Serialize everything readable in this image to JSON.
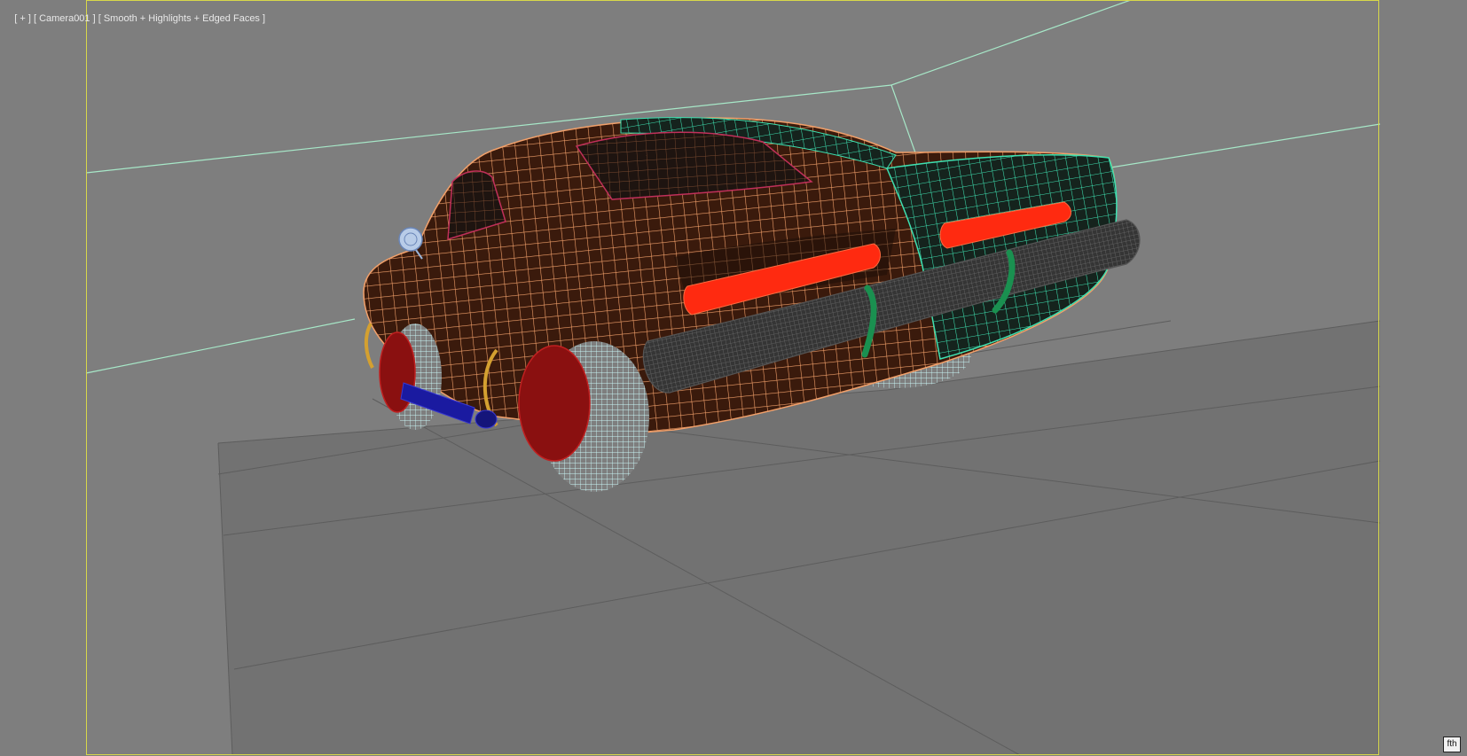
{
  "viewport": {
    "label_plus": "[ + ]",
    "label_camera": "[ Camera001 ]",
    "label_shading": "[ Smooth + Highlights + Edged Faces ]",
    "corner_badge": "fth"
  },
  "scene": {
    "object": "car-wireframe-model",
    "colors": {
      "background": "#7e7e7e",
      "floor": "#727272",
      "wall_line": "#a7e8c8",
      "safe_frame": "#d8d84a",
      "body_wire": "#f2a06a",
      "body_fill": "#3a1a0c",
      "teal_wire": "#3ee0b0",
      "tail_light": "#ff2a10",
      "bumper": "#4a4a4a",
      "tire_wire": "#c8f4f4",
      "rim": "#8a1010",
      "exhaust": "#1a1aa0",
      "bumper_guard": "#1a9050",
      "fender_trim": "#d4a030"
    }
  }
}
